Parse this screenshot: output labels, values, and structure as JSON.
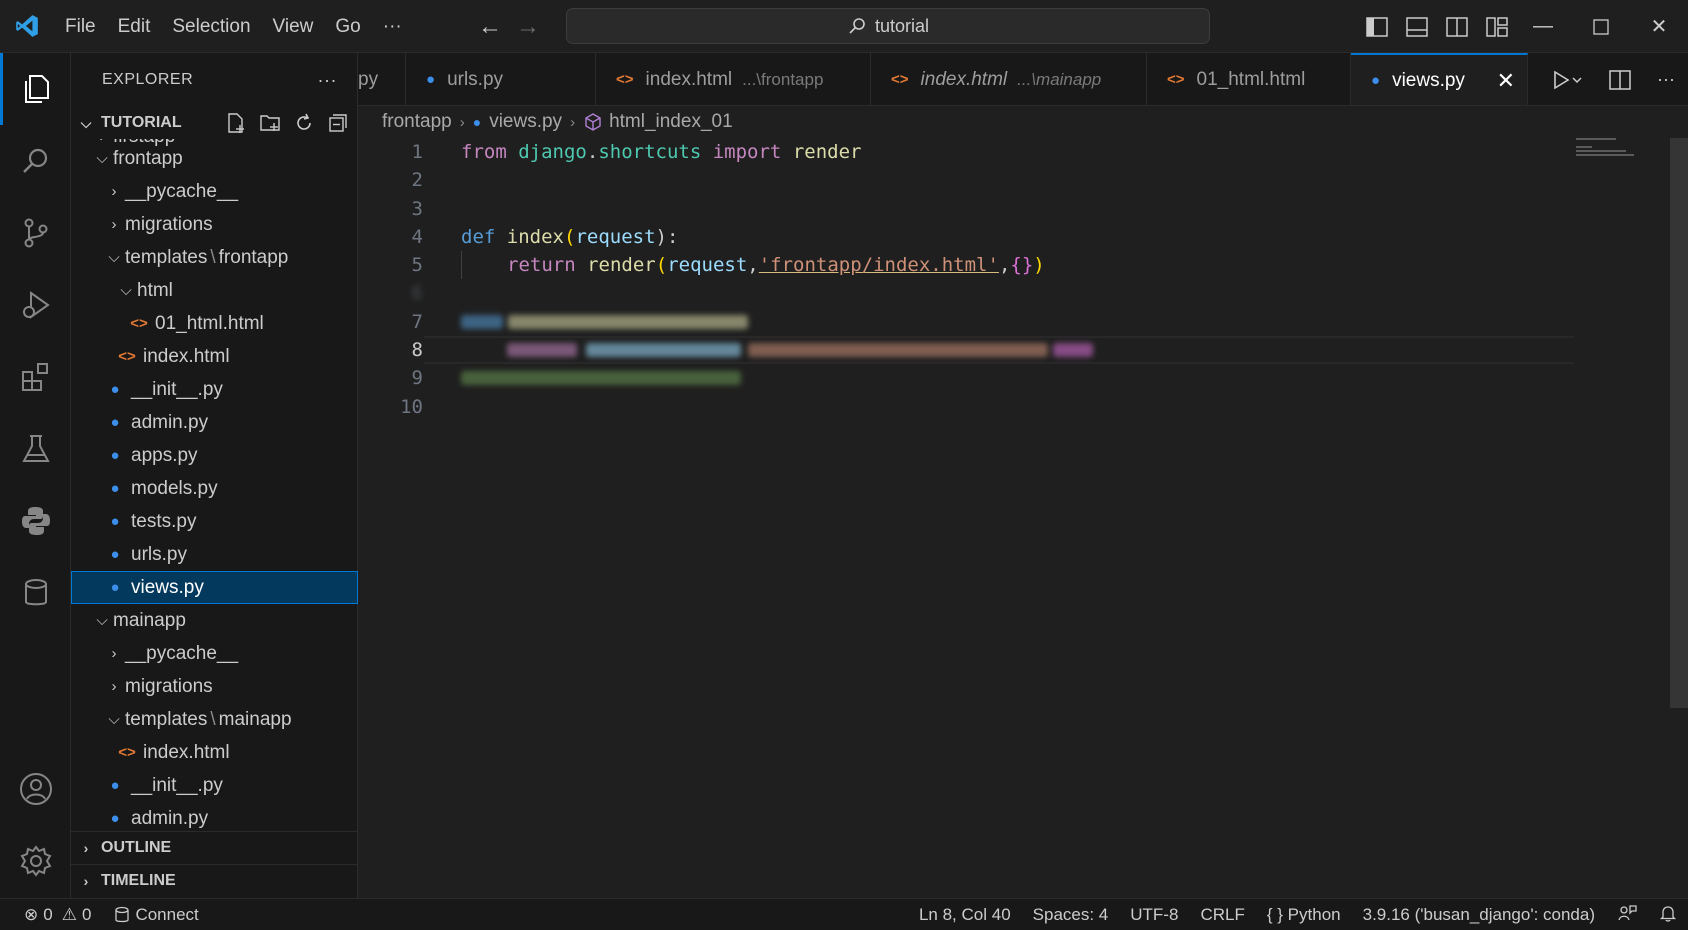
{
  "titlebar": {
    "menu": [
      "File",
      "Edit",
      "Selection",
      "View",
      "Go",
      "···"
    ],
    "search_text": "tutorial"
  },
  "explorer": {
    "title": "EXPLORER",
    "more": "···",
    "root_label": "TUTORIAL",
    "tree": [
      {
        "label": "firstapp",
        "type": "folder-open"
      },
      {
        "label": "frontapp",
        "type": "folder-open"
      },
      {
        "label": "__pycache__",
        "type": "folder"
      },
      {
        "label": "migrations",
        "type": "folder"
      },
      {
        "label": "templates",
        "label2": "frontapp",
        "type": "folder-open"
      },
      {
        "label": "html",
        "type": "folder-open"
      },
      {
        "label": "01_html.html",
        "type": "html"
      },
      {
        "label": "index.html",
        "type": "html"
      },
      {
        "label": "__init__.py",
        "type": "py"
      },
      {
        "label": "admin.py",
        "type": "py"
      },
      {
        "label": "apps.py",
        "type": "py"
      },
      {
        "label": "models.py",
        "type": "py"
      },
      {
        "label": "tests.py",
        "type": "py"
      },
      {
        "label": "urls.py",
        "type": "py"
      },
      {
        "label": "views.py",
        "type": "py"
      },
      {
        "label": "mainapp",
        "type": "folder-open"
      },
      {
        "label": "__pycache__",
        "type": "folder"
      },
      {
        "label": "migrations",
        "type": "folder"
      },
      {
        "label": "templates",
        "label2": "mainapp",
        "type": "folder-open"
      },
      {
        "label": "index.html",
        "type": "html"
      },
      {
        "label": "__init__.py",
        "type": "py"
      },
      {
        "label": "admin.py",
        "type": "py"
      }
    ],
    "outline_label": "OUTLINE",
    "timeline_label": "TIMELINE"
  },
  "tabs": [
    {
      "label": "py",
      "desc": ""
    },
    {
      "label": "urls.py",
      "desc": ""
    },
    {
      "label": "index.html",
      "desc": "...\\frontapp"
    },
    {
      "label": "index.html",
      "desc": "...\\mainapp"
    },
    {
      "label": "01_html.html",
      "desc": ""
    },
    {
      "label": "views.py",
      "desc": ""
    }
  ],
  "breadcrumb": {
    "folder": "frontapp",
    "file": "views.py",
    "symbol": "html_index_01"
  },
  "editor": {
    "line_numbers": [
      "1",
      "2",
      "3",
      "4",
      "5",
      "6",
      "7",
      "8",
      "9",
      "10"
    ],
    "line1": {
      "kw_from": "from",
      "module": "django",
      "dot": ".",
      "module2": "shortcuts",
      "kw_import": "import",
      "name": "render"
    },
    "line4": {
      "kw_def": "def",
      "fn": "index",
      "open": "(",
      "param": "request",
      "close": "):"
    },
    "line5": {
      "kw_return": "return",
      "fn": "render",
      "open": "(",
      "arg": "request",
      "comma": ",",
      "str": "'frontapp/index.html'",
      "comma2": ",",
      "braces": "{}",
      "close": ")"
    }
  },
  "statusbar": {
    "errors": "0",
    "warnings": "0",
    "connect": "Connect",
    "position": "Ln 8, Col 40",
    "spaces": "Spaces: 4",
    "encoding": "UTF-8",
    "eol": "CRLF",
    "language_braces": "{ }",
    "language": "Python",
    "interpreter": "3.9.16 ('busan_django': conda)"
  },
  "colors": {
    "accent": "#0078d4",
    "python_icon": "#3b8eea",
    "html_icon": "#e37933"
  }
}
